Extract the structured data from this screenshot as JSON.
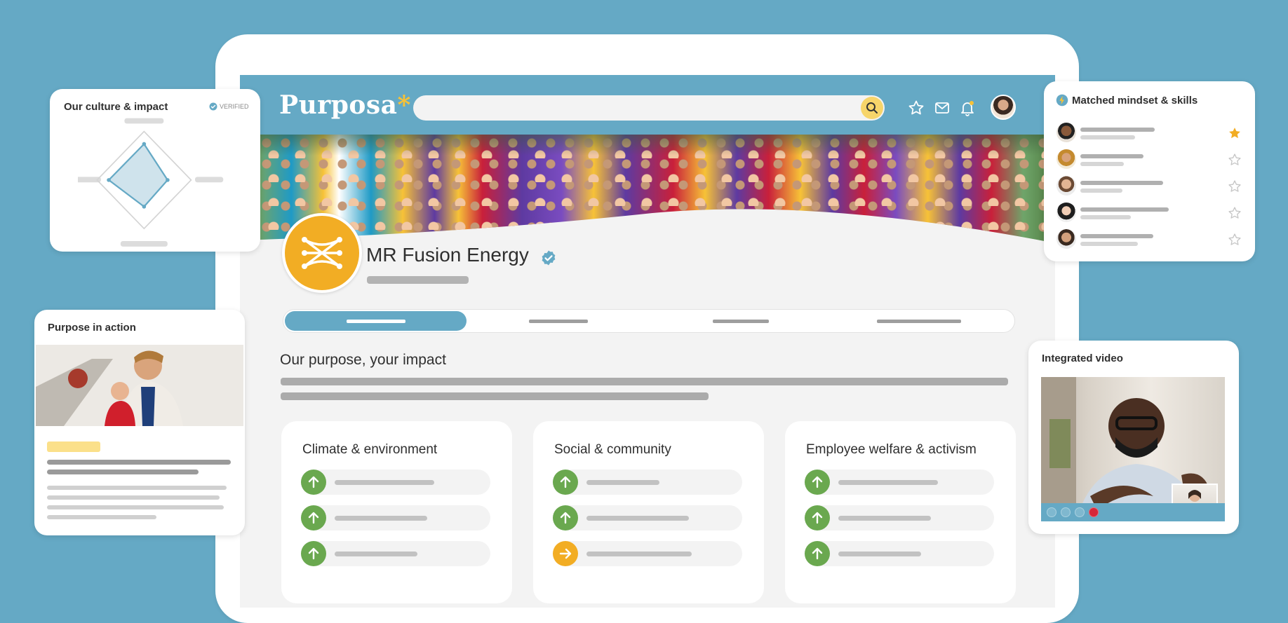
{
  "brand": {
    "name": "Purposa",
    "asterisk": "*"
  },
  "company": {
    "name": "MR Fusion Energy"
  },
  "section": {
    "title": "Our purpose, your impact"
  },
  "cards": [
    {
      "title": "Climate & environment",
      "items": [
        "up",
        "up",
        "up"
      ]
    },
    {
      "title": "Social & community",
      "items": [
        "up",
        "up",
        "right"
      ]
    },
    {
      "title": "Employee welfare & activism",
      "items": [
        "up",
        "up",
        "up"
      ]
    }
  ],
  "culture_widget": {
    "title": "Our culture & impact",
    "verified_label": "VERIFIED"
  },
  "purpose_widget": {
    "title": "Purpose in action"
  },
  "mindset_widget": {
    "title": "Matched mindset & skills",
    "starred": [
      true,
      false,
      false,
      false,
      false
    ]
  },
  "video_widget": {
    "title": "Integrated video"
  },
  "colors": {
    "background": "#65a9c5",
    "accent_yellow": "#f2ad24",
    "up_green": "#6aa84f",
    "right_orange": "#f2ad24",
    "star_gold": "#f2ad24"
  }
}
